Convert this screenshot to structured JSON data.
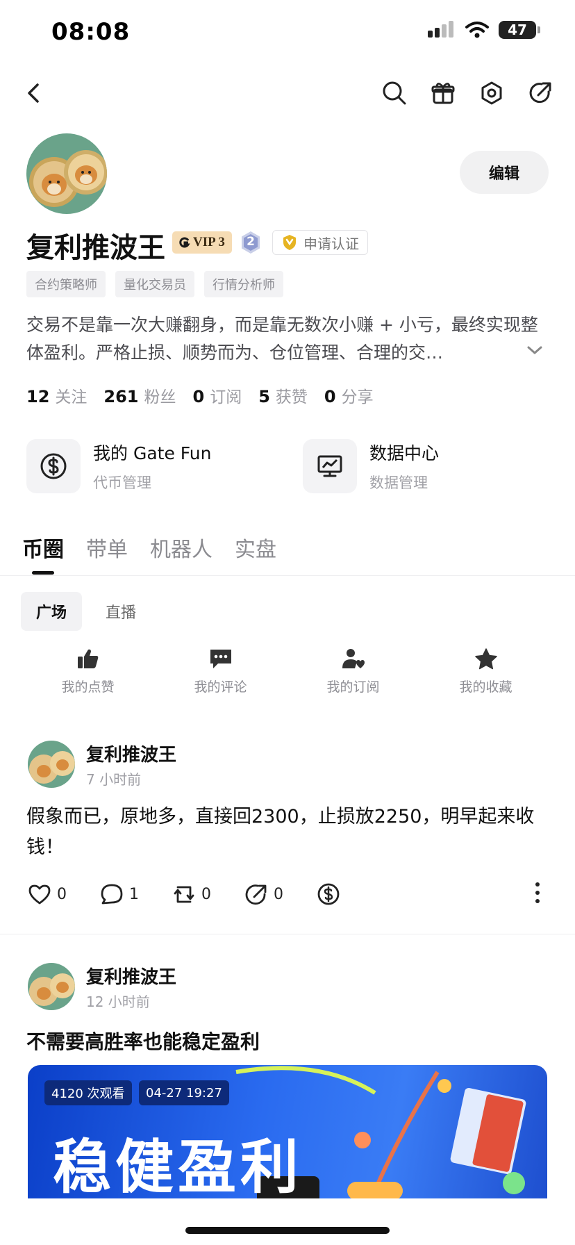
{
  "status_bar": {
    "time": "08:08",
    "battery": "47"
  },
  "profile": {
    "name": "复利推波王",
    "edit_label": "编辑",
    "vip_label": "VIP 3",
    "level": "2",
    "verify_label": "申请认证",
    "tags": [
      "合约策略师",
      "量化交易员",
      "行情分析师"
    ],
    "bio": "交易不是靠一次大赚翻身，而是靠无数次小赚 + 小亏，最终实现整体盈利。严格止损、顺势而为、仓位管理、合理的交…",
    "stats": [
      {
        "num": "12",
        "label": "关注"
      },
      {
        "num": "261",
        "label": "粉丝"
      },
      {
        "num": "0",
        "label": "订阅"
      },
      {
        "num": "5",
        "label": "获赞"
      },
      {
        "num": "0",
        "label": "分享"
      }
    ]
  },
  "cards": [
    {
      "title": "我的 Gate Fun",
      "sub": "代币管理",
      "icon": "dollar-coin-icon"
    },
    {
      "title": "数据中心",
      "sub": "数据管理",
      "icon": "chart-monitor-icon"
    }
  ],
  "tabs": [
    "币圈",
    "带单",
    "机器人",
    "实盘"
  ],
  "subtabs": [
    "广场",
    "直播"
  ],
  "quick_actions": [
    {
      "label": "我的点赞",
      "icon": "thumbs-up-icon"
    },
    {
      "label": "我的评论",
      "icon": "comment-icon"
    },
    {
      "label": "我的订阅",
      "icon": "subscribe-icon"
    },
    {
      "label": "我的收藏",
      "icon": "star-icon"
    }
  ],
  "posts": [
    {
      "author": "复利推波王",
      "time": "7 小时前",
      "text": "假象而已，原地多，直接回2300，止损放2250，明早起来收钱！",
      "likes": "0",
      "comments": "1",
      "reposts": "0",
      "shares": "0"
    },
    {
      "author": "复利推波王",
      "time": "12 小时前",
      "title": "不需要高胜率也能稳定盈利",
      "banner": {
        "views": "4120 次观看",
        "date": "04-27 19:27",
        "headline": "稳健盈利"
      }
    }
  ],
  "colors": {
    "vip_bg": "#f6dcb4",
    "banner_blue": "#2a6bf0",
    "verify_gold": "#e6b422"
  }
}
